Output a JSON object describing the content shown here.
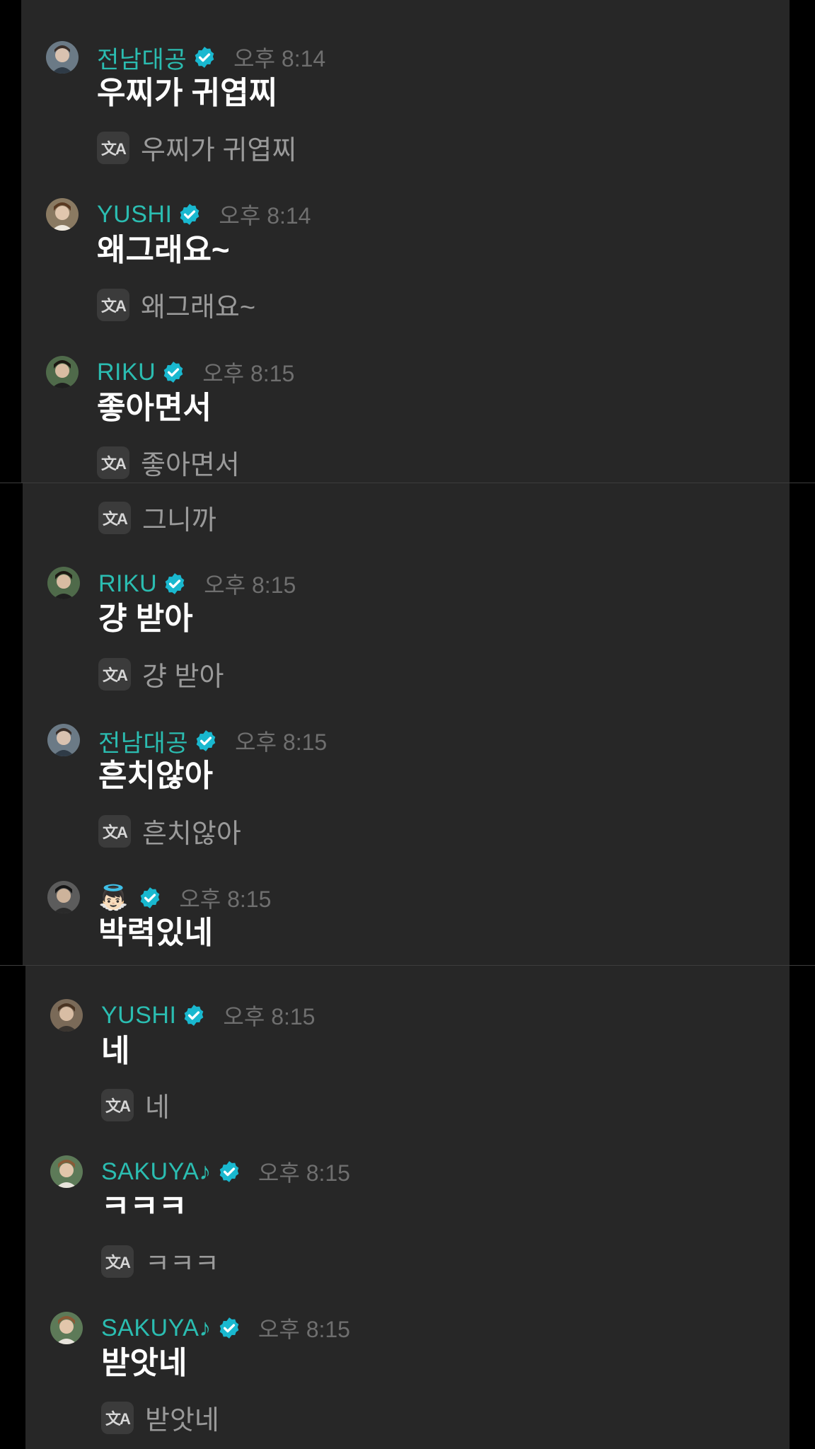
{
  "colors": {
    "name": "#2bbdb1",
    "badge": "#19b8cf",
    "time": "#6f6f6f",
    "panel": "#272727"
  },
  "icons": {
    "verified": "verified-badge-icon",
    "translate": "translate-icon"
  },
  "translate_icon_glyph": "文A",
  "panel1": {
    "messages": [
      {
        "name": "전남대공",
        "time": "오후 8:14",
        "text": "우찌가 귀엽찌",
        "translation": "우찌가 귀엽찌"
      },
      {
        "name": "YUSHI",
        "time": "오후 8:14",
        "text": "왜그래요~",
        "translation": "왜그래요~"
      },
      {
        "name": "RIKU",
        "time": "오후 8:15",
        "text": "좋아면서",
        "translation": "좋아면서"
      }
    ]
  },
  "panel2": {
    "partial_translation": "그니까",
    "messages": [
      {
        "name": "RIKU",
        "time": "오후 8:15",
        "text": "걍 받아",
        "translation": "걍 받아"
      },
      {
        "name": "전남대공",
        "time": "오후 8:15",
        "text": "흔치않아",
        "translation": "흔치않아"
      },
      {
        "name": "👼🏻",
        "time": "오후 8:15",
        "text": "박력있네"
      }
    ]
  },
  "panel3": {
    "messages": [
      {
        "name": "YUSHI",
        "time": "오후 8:15",
        "text": "네",
        "translation": "네"
      },
      {
        "name": "SAKUYA♪",
        "time": "오후 8:15",
        "text": "ㅋㅋㅋ",
        "translation": "ㅋㅋㅋ"
      },
      {
        "name": "SAKUYA♪",
        "time": "오후 8:15",
        "text": "받앗네",
        "translation": "받앗네"
      }
    ]
  }
}
